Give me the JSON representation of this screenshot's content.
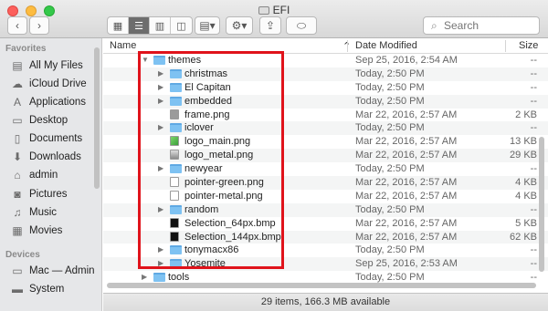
{
  "window": {
    "title": "EFI"
  },
  "toolbar": {
    "back_icon": "chevron-left-icon",
    "forward_icon": "chevron-right-icon",
    "view_modes": [
      "icon-view",
      "list-view",
      "column-view",
      "cover-flow-view"
    ],
    "active_view": "list-view",
    "search_placeholder": "Search"
  },
  "sidebar": {
    "favorites_header": "Favorites",
    "favorites": [
      {
        "label": "All My Files",
        "icon": "all-files-icon"
      },
      {
        "label": "iCloud Drive",
        "icon": "cloud-icon"
      },
      {
        "label": "Applications",
        "icon": "applications-icon"
      },
      {
        "label": "Desktop",
        "icon": "desktop-icon"
      },
      {
        "label": "Documents",
        "icon": "documents-icon"
      },
      {
        "label": "Downloads",
        "icon": "downloads-icon"
      },
      {
        "label": "admin",
        "icon": "home-icon"
      },
      {
        "label": "Pictures",
        "icon": "camera-icon"
      },
      {
        "label": "Music",
        "icon": "music-icon"
      },
      {
        "label": "Movies",
        "icon": "movies-icon"
      }
    ],
    "devices_header": "Devices",
    "devices": [
      {
        "label": "Mac — Admin",
        "icon": "laptop-icon"
      },
      {
        "label": "System",
        "icon": "disk-icon"
      }
    ]
  },
  "columns": {
    "name": "Name",
    "date": "Date Modified",
    "size": "Size"
  },
  "rows": [
    {
      "name": "themes",
      "date": "Sep 25, 2016, 2:54 AM",
      "size": "--",
      "kind": "folder",
      "expanded": true,
      "level": 0
    },
    {
      "name": "christmas",
      "date": "Today, 2:50 PM",
      "size": "--",
      "kind": "folder",
      "level": 1
    },
    {
      "name": "El Capitan",
      "date": "Today, 2:50 PM",
      "size": "--",
      "kind": "folder",
      "level": 1
    },
    {
      "name": "embedded",
      "date": "Today, 2:50 PM",
      "size": "--",
      "kind": "folder",
      "level": 1
    },
    {
      "name": "frame.png",
      "date": "Mar 22, 2016, 2:57 AM",
      "size": "2 KB",
      "kind": "file-gray",
      "level": 1
    },
    {
      "name": "iclover",
      "date": "Today, 2:50 PM",
      "size": "--",
      "kind": "folder",
      "level": 1
    },
    {
      "name": "logo_main.png",
      "date": "Mar 22, 2016, 2:57 AM",
      "size": "13 KB",
      "kind": "file-green",
      "level": 1
    },
    {
      "name": "logo_metal.png",
      "date": "Mar 22, 2016, 2:57 AM",
      "size": "29 KB",
      "kind": "file-metal",
      "level": 1
    },
    {
      "name": "newyear",
      "date": "Today, 2:50 PM",
      "size": "--",
      "kind": "folder",
      "level": 1
    },
    {
      "name": "pointer-green.png",
      "date": "Mar 22, 2016, 2:57 AM",
      "size": "4 KB",
      "kind": "file-ptr",
      "level": 1
    },
    {
      "name": "pointer-metal.png",
      "date": "Mar 22, 2016, 2:57 AM",
      "size": "4 KB",
      "kind": "file-ptr",
      "level": 1
    },
    {
      "name": "random",
      "date": "Today, 2:50 PM",
      "size": "--",
      "kind": "folder",
      "level": 1
    },
    {
      "name": "Selection_64px.bmp",
      "date": "Mar 22, 2016, 2:57 AM",
      "size": "5 KB",
      "kind": "file-black",
      "level": 1
    },
    {
      "name": "Selection_144px.bmp",
      "date": "Mar 22, 2016, 2:57 AM",
      "size": "62 KB",
      "kind": "file-black",
      "level": 1
    },
    {
      "name": "tonymacx86",
      "date": "Today, 2:50 PM",
      "size": "--",
      "kind": "folder",
      "level": 1
    },
    {
      "name": "Yosemite",
      "date": "Sep 25, 2016, 2:53 AM",
      "size": "--",
      "kind": "folder",
      "level": 1
    },
    {
      "name": "tools",
      "date": "Today, 2:50 PM",
      "size": "--",
      "kind": "folder",
      "level": 0
    }
  ],
  "status": {
    "text": "29 items, 166.3 MB available"
  },
  "colors": {
    "highlight": "#e0131b",
    "folder": "#7ec2f2"
  }
}
